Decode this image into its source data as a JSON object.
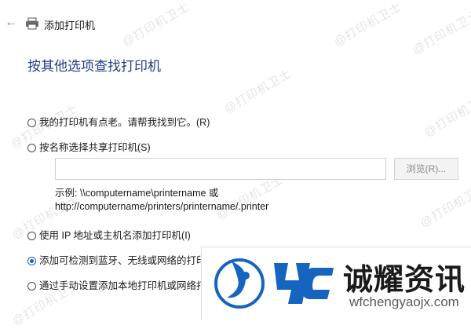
{
  "window": {
    "title": "添加打印机"
  },
  "watermark_text": "@打印机卫士",
  "heading": "按其他选项查找打印机",
  "options": [
    {
      "label": "我的打印机有点老。请帮我找到它。(R)",
      "selected": false
    },
    {
      "label": "按名称选择共享打印机(S)",
      "selected": false
    },
    {
      "label": "使用 IP 地址或主机名添加打印机(I)",
      "selected": false
    },
    {
      "label": "添加可检测到蓝牙、无线或网络的打印",
      "selected": true
    },
    {
      "label": "通过手动设置添加本地打印机或网络打",
      "selected": false
    }
  ],
  "name_input": {
    "value": "",
    "placeholder": ""
  },
  "browse_label": "浏览(R)...",
  "example": {
    "line1": "示例: \\\\computername\\printername 或",
    "line2": "http://computername/printers/printername/.printer"
  },
  "brand": {
    "name": "诚耀资讯",
    "url": "wfchengyaojx.com"
  },
  "colors": {
    "accent": "#1f5fbf",
    "heading": "#1f3f8a",
    "logo_blue": "#1565c0"
  }
}
